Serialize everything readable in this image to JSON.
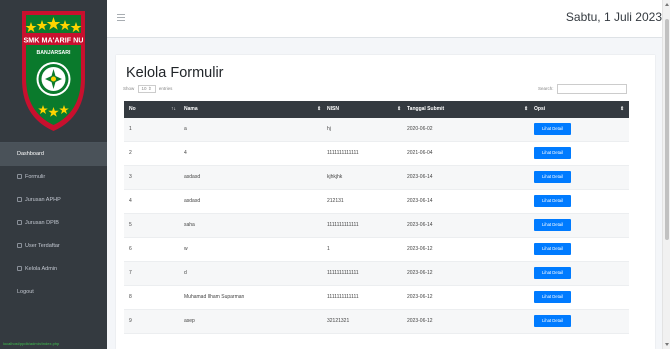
{
  "sidebar": {
    "logo_name": "SMK MA'ARIF NU",
    "logo_city": "BANJARSARI",
    "nav": [
      {
        "label": "Dashboard",
        "active": true
      },
      {
        "label": "Formulir"
      },
      {
        "label": "Jurusan APHP"
      },
      {
        "label": "Jurusan DPIB"
      },
      {
        "label": "User Terdaftar"
      },
      {
        "label": "Kelola Admin"
      },
      {
        "label": "Logout"
      }
    ],
    "status_url": "localhost/ppdb/admin/index.php"
  },
  "topbar": {
    "date": "Sabtu, 1 Juli 2023"
  },
  "page": {
    "title": "Kelola Formulir",
    "show_label": "Show",
    "entries_value": "10",
    "entries_label": "entries",
    "search_label": "Search:"
  },
  "table": {
    "columns": [
      "No",
      "Nama",
      "NISN",
      "Tanggal Submit",
      "Opsi"
    ],
    "rows": [
      {
        "no": "1",
        "nama": "a",
        "nisn": "hj",
        "tanggal": "2020-06-02",
        "action": "Lihat Detail"
      },
      {
        "no": "2",
        "nama": "4",
        "nisn": "1111111111111",
        "tanggal": "2021-06-04",
        "action": "Lihat Detail"
      },
      {
        "no": "3",
        "nama": "asdasd",
        "nisn": "kjhkjhk",
        "tanggal": "2023-06-14",
        "action": "Lihat Detail"
      },
      {
        "no": "4",
        "nama": "asdasd",
        "nisn": "212131",
        "tanggal": "2023-06-14",
        "action": "Lihat Detail"
      },
      {
        "no": "5",
        "nama": "saha",
        "nisn": "1111111111111",
        "tanggal": "2023-06-14",
        "action": "Lihat Detail"
      },
      {
        "no": "6",
        "nama": "w",
        "nisn": "1",
        "tanggal": "2023-06-12",
        "action": "Lihat Detail"
      },
      {
        "no": "7",
        "nama": "d",
        "nisn": "1111111111111",
        "tanggal": "2023-06-12",
        "action": "Lihat Detail"
      },
      {
        "no": "8",
        "nama": "Muhamad Ilham Suparman",
        "nisn": "1111111111111",
        "tanggal": "2023-06-12",
        "action": "Lihat Detail"
      },
      {
        "no": "9",
        "nama": "asep",
        "nisn": "32121321",
        "tanggal": "2023-06-12",
        "action": "Lihat Detail"
      }
    ]
  },
  "colors": {
    "sidebar_bg": "#343a40",
    "header_bg": "#343a40",
    "button_primary": "#007bff",
    "shield_green": "#0a7a2c",
    "shield_red": "#c8102e",
    "star_yellow": "#ffd400"
  }
}
